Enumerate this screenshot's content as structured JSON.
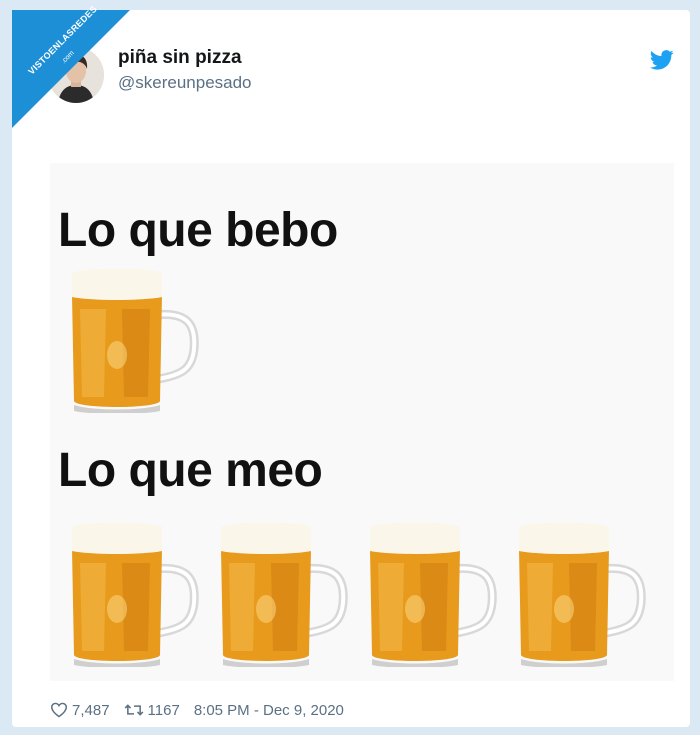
{
  "watermark": {
    "text": "VISTOENLASREDES",
    "suffix": ".com"
  },
  "tweet": {
    "display_name": "piña sin pizza",
    "handle": "@skereunpesado",
    "likes": "7,487",
    "retweets": "1167",
    "timestamp": "8:05 PM - Dec 9, 2020"
  },
  "meme": {
    "caption_top": "Lo que bebo",
    "caption_bottom": "Lo que meo",
    "mugs_top": 1,
    "mugs_bottom": 4
  },
  "colors": {
    "twitter_blue": "#1da1f2",
    "badge_blue": "#1d8fd6",
    "beer": "#e89a1c",
    "foam": "#fbf6ea"
  },
  "icons": [
    "heart-icon",
    "retweet-icon",
    "twitter-bird-icon"
  ]
}
